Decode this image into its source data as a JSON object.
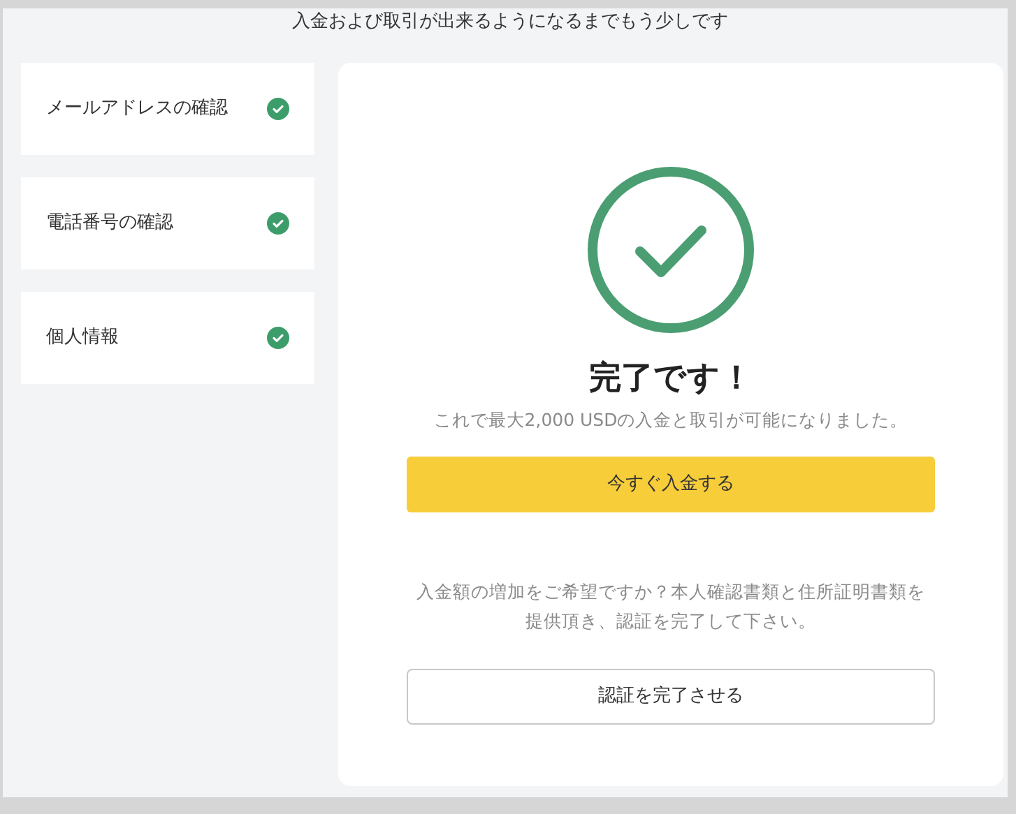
{
  "header": {
    "text": "入金および取引が出来るようになるまでもう少しです"
  },
  "steps": [
    {
      "label": "メールアドレスの確認",
      "checked": true
    },
    {
      "label": "電話番号の確認",
      "checked": true
    },
    {
      "label": "個人情報",
      "checked": true
    }
  ],
  "result": {
    "title": "完了です！",
    "subtitle": "これで最大2,000 USDの入金と取引が可能になりました。",
    "primary_button": "今すぐ入金する",
    "note_lines": [
      "入金額の増加をご希望ですか？本人確認書類と住所証明書類を",
      "提供頂き、認証を完了して下さい。"
    ],
    "secondary_button": "認証を完了させる"
  }
}
